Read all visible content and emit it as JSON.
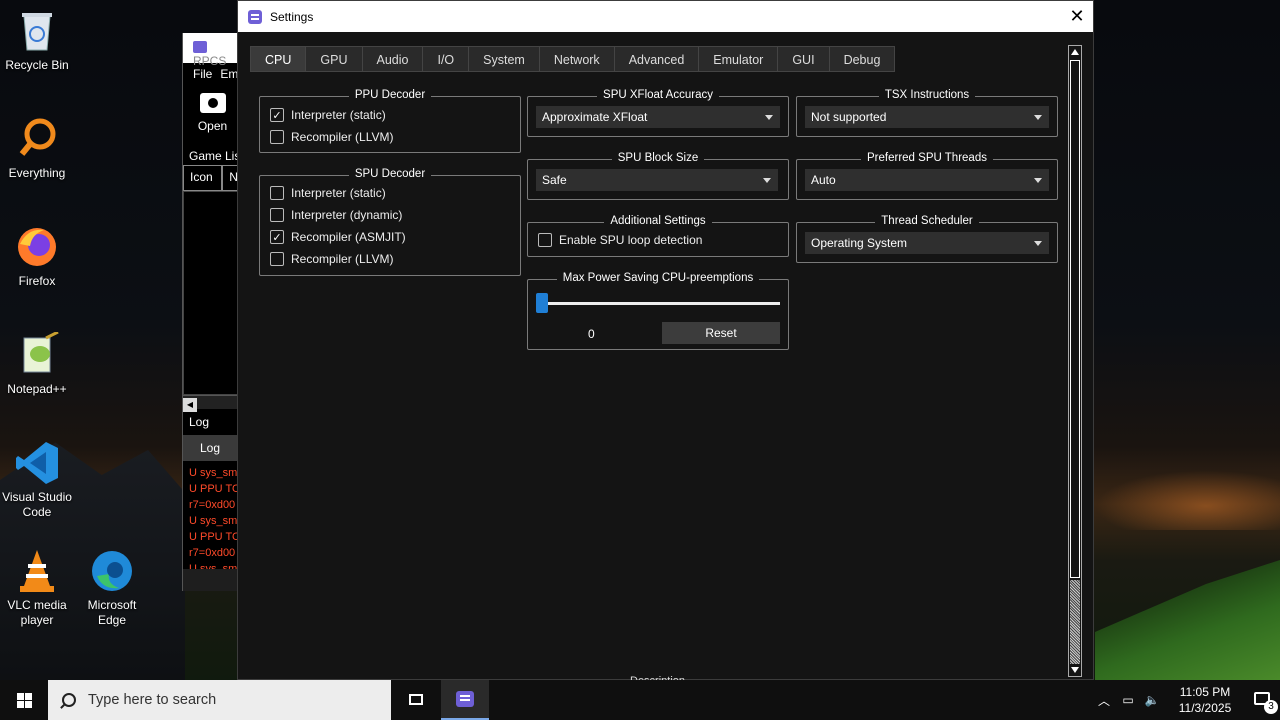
{
  "desktop": {
    "icons": [
      {
        "label": "Recycle Bin"
      },
      {
        "label": "Everything"
      },
      {
        "label": "Firefox"
      },
      {
        "label": "Notepad++"
      },
      {
        "label": "Visual Studio Code"
      },
      {
        "label": "VLC media player"
      },
      {
        "label": "Microsoft Edge"
      }
    ]
  },
  "main_window": {
    "title": "RPCS",
    "menu": [
      "File",
      "Em"
    ],
    "open_label": "Open",
    "game_list_label": "Game Lis",
    "columns": [
      "Icon",
      "N"
    ],
    "log_title": "Log",
    "log_tab": "Log",
    "log_lines": [
      "U sys_sm",
      "U PPU TO",
      "r7=0xd00",
      "U sys_sm",
      "U PPU TO",
      "r7=0xd00",
      "U sys_sm"
    ]
  },
  "settings": {
    "title": "Settings",
    "tabs": [
      "CPU",
      "GPU",
      "Audio",
      "I/O",
      "System",
      "Network",
      "Advanced",
      "Emulator",
      "GUI",
      "Debug"
    ],
    "active_tab": "CPU",
    "ppu_decoder": {
      "title": "PPU Decoder",
      "options": [
        {
          "label": "Interpreter (static)",
          "checked": true
        },
        {
          "label": "Recompiler (LLVM)",
          "checked": false
        }
      ]
    },
    "spu_decoder": {
      "title": "SPU Decoder",
      "options": [
        {
          "label": "Interpreter (static)",
          "checked": false
        },
        {
          "label": "Interpreter (dynamic)",
          "checked": false
        },
        {
          "label": "Recompiler (ASMJIT)",
          "checked": true
        },
        {
          "label": "Recompiler (LLVM)",
          "checked": false
        }
      ]
    },
    "spu_xfloat": {
      "title": "SPU XFloat Accuracy",
      "value": "Approximate XFloat"
    },
    "tsx": {
      "title": "TSX Instructions",
      "value": "Not supported"
    },
    "spu_block": {
      "title": "SPU Block Size",
      "value": "Safe"
    },
    "spu_threads": {
      "title": "Preferred SPU Threads",
      "value": "Auto"
    },
    "additional": {
      "title": "Additional Settings",
      "spu_loop_label": "Enable SPU loop detection",
      "spu_loop_checked": false
    },
    "scheduler": {
      "title": "Thread Scheduler",
      "value": "Operating System"
    },
    "power_saving": {
      "title": "Max Power Saving CPU-preemptions",
      "value": "0",
      "fraction": 0,
      "reset_label": "Reset"
    },
    "description_label": "Description"
  },
  "taskbar": {
    "search_placeholder": "Type here to search",
    "time": "11:05 PM",
    "date": "11/3/2025",
    "notification_count": "3"
  }
}
